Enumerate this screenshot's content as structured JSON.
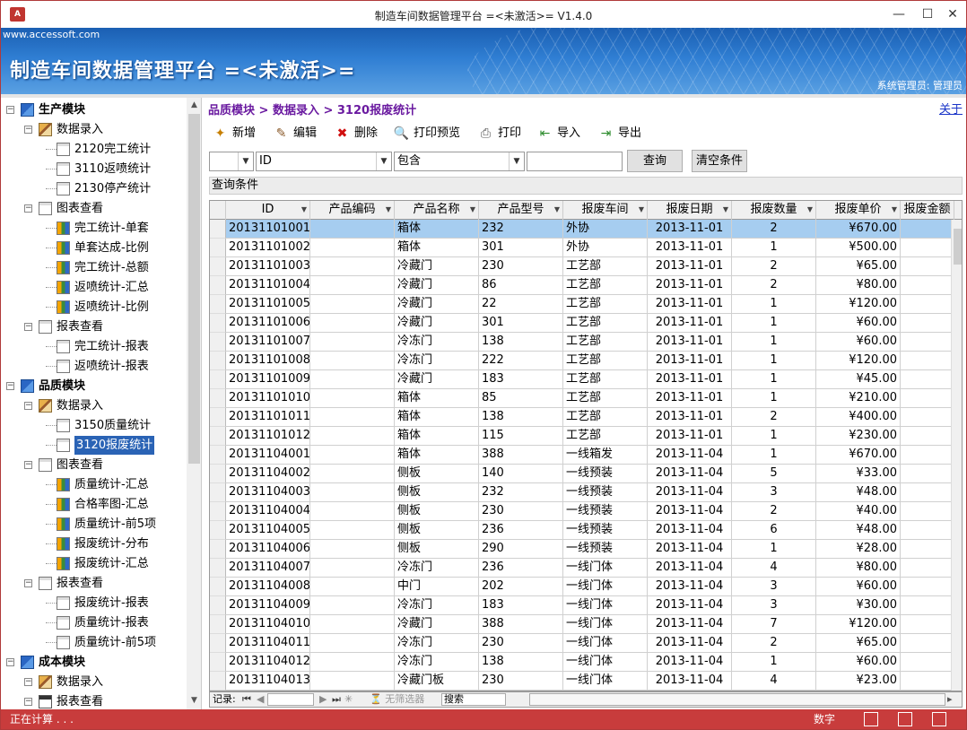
{
  "window": {
    "title": "制造车间数据管理平台 =<未激活>= V1.4.0",
    "app_icon": "A"
  },
  "banner": {
    "url": "www.accessoft.com",
    "title": "制造车间数据管理平台 =<未激活>=",
    "user": "系统管理员: 管理员"
  },
  "tree": {
    "items": [
      {
        "label": "生产模块",
        "level": 0,
        "icon": "module-icon",
        "bold": true
      },
      {
        "label": "数据录入",
        "level": 1,
        "icon": "data-entry-icon"
      },
      {
        "label": "2120完工统计",
        "level": 2,
        "icon": "document-icon"
      },
      {
        "label": "3110返喷统计",
        "level": 2,
        "icon": "document-icon"
      },
      {
        "label": "2130停产统计",
        "level": 2,
        "icon": "document-icon"
      },
      {
        "label": "图表查看",
        "level": 1,
        "icon": "chart-folder-icon"
      },
      {
        "label": "完工统计-单套",
        "level": 2,
        "icon": "chart-icon"
      },
      {
        "label": "单套达成-比例",
        "level": 2,
        "icon": "chart-icon"
      },
      {
        "label": "完工统计-总额",
        "level": 2,
        "icon": "chart-icon"
      },
      {
        "label": "返喷统计-汇总",
        "level": 2,
        "icon": "chart-icon"
      },
      {
        "label": "返喷统计-比例",
        "level": 2,
        "icon": "chart-icon"
      },
      {
        "label": "报表查看",
        "level": 1,
        "icon": "chart-folder-icon"
      },
      {
        "label": "完工统计-报表",
        "level": 2,
        "icon": "document-icon"
      },
      {
        "label": "返喷统计-报表",
        "level": 2,
        "icon": "document-icon"
      },
      {
        "label": "品质模块",
        "level": 0,
        "icon": "module-icon",
        "bold": true
      },
      {
        "label": "数据录入",
        "level": 1,
        "icon": "data-entry-icon"
      },
      {
        "label": "3150质量统计",
        "level": 2,
        "icon": "document-icon"
      },
      {
        "label": "3120报废统计",
        "level": 2,
        "icon": "document-icon",
        "selected": true
      },
      {
        "label": "图表查看",
        "level": 1,
        "icon": "chart-folder-icon"
      },
      {
        "label": "质量统计-汇总",
        "level": 2,
        "icon": "chart-icon"
      },
      {
        "label": "合格率图-汇总",
        "level": 2,
        "icon": "chart-icon"
      },
      {
        "label": "质量统计-前5项",
        "level": 2,
        "icon": "chart-icon"
      },
      {
        "label": "报废统计-分布",
        "level": 2,
        "icon": "chart-icon"
      },
      {
        "label": "报废统计-汇总",
        "level": 2,
        "icon": "chart-icon"
      },
      {
        "label": "报表查看",
        "level": 1,
        "icon": "chart-folder-icon"
      },
      {
        "label": "报废统计-报表",
        "level": 2,
        "icon": "document-icon"
      },
      {
        "label": "质量统计-报表",
        "level": 2,
        "icon": "document-icon"
      },
      {
        "label": "质量统计-前5项",
        "level": 2,
        "icon": "document-icon"
      },
      {
        "label": "成本模块",
        "level": 0,
        "icon": "module-icon",
        "bold": true
      },
      {
        "label": "数据录入",
        "level": 1,
        "icon": "data-entry-icon"
      },
      {
        "label": "报表查看",
        "level": 1,
        "icon": "report-icon"
      }
    ]
  },
  "main": {
    "breadcrumb": "品质模块 > 数据录入 > 3120报废统计",
    "about": "关于",
    "toolbar": [
      {
        "label": "新增",
        "icon": "add-icon"
      },
      {
        "label": "编辑",
        "icon": "edit-icon"
      },
      {
        "label": "删除",
        "icon": "delete-icon"
      },
      {
        "label": "打印预览",
        "icon": "print-preview-icon"
      },
      {
        "label": "打印",
        "icon": "print-icon"
      },
      {
        "label": "导入",
        "icon": "import-icon"
      },
      {
        "label": "导出",
        "icon": "export-icon"
      }
    ],
    "filter": {
      "field1": "",
      "field2": "ID",
      "operator": "包含",
      "value": "",
      "query_label": "查询",
      "clear_label": "清空条件"
    },
    "condition_label": "查询条件",
    "columns": [
      "ID",
      "产品编码",
      "产品名称",
      "产品型号",
      "报废车间",
      "报废日期",
      "报废数量",
      "报废单价",
      "报废金额"
    ],
    "rows": [
      [
        "20131101001",
        "",
        "箱体",
        "232",
        "外协",
        "2013-11-01",
        "2",
        "¥670.00"
      ],
      [
        "20131101002",
        "",
        "箱体",
        "301",
        "外协",
        "2013-11-01",
        "1",
        "¥500.00"
      ],
      [
        "20131101003",
        "",
        "冷藏门",
        "230",
        "工艺部",
        "2013-11-01",
        "2",
        "¥65.00"
      ],
      [
        "20131101004",
        "",
        "冷藏门",
        "86",
        "工艺部",
        "2013-11-01",
        "2",
        "¥80.00"
      ],
      [
        "20131101005",
        "",
        "冷藏门",
        "22",
        "工艺部",
        "2013-11-01",
        "1",
        "¥120.00"
      ],
      [
        "20131101006",
        "",
        "冷藏门",
        "301",
        "工艺部",
        "2013-11-01",
        "1",
        "¥60.00"
      ],
      [
        "20131101007",
        "",
        "冷冻门",
        "138",
        "工艺部",
        "2013-11-01",
        "1",
        "¥60.00"
      ],
      [
        "20131101008",
        "",
        "冷冻门",
        "222",
        "工艺部",
        "2013-11-01",
        "1",
        "¥120.00"
      ],
      [
        "20131101009",
        "",
        "冷藏门",
        "183",
        "工艺部",
        "2013-11-01",
        "1",
        "¥45.00"
      ],
      [
        "20131101010",
        "",
        "箱体",
        "85",
        "工艺部",
        "2013-11-01",
        "1",
        "¥210.00"
      ],
      [
        "20131101011",
        "",
        "箱体",
        "138",
        "工艺部",
        "2013-11-01",
        "2",
        "¥400.00"
      ],
      [
        "20131101012",
        "",
        "箱体",
        "115",
        "工艺部",
        "2013-11-01",
        "1",
        "¥230.00"
      ],
      [
        "20131104001",
        "",
        "箱体",
        "388",
        "一线箱发",
        "2013-11-04",
        "1",
        "¥670.00"
      ],
      [
        "20131104002",
        "",
        "侧板",
        "140",
        "一线预装",
        "2013-11-04",
        "5",
        "¥33.00"
      ],
      [
        "20131104003",
        "",
        "侧板",
        "232",
        "一线预装",
        "2013-11-04",
        "3",
        "¥48.00"
      ],
      [
        "20131104004",
        "",
        "侧板",
        "230",
        "一线预装",
        "2013-11-04",
        "2",
        "¥40.00"
      ],
      [
        "20131104005",
        "",
        "侧板",
        "236",
        "一线预装",
        "2013-11-04",
        "6",
        "¥48.00"
      ],
      [
        "20131104006",
        "",
        "侧板",
        "290",
        "一线预装",
        "2013-11-04",
        "1",
        "¥28.00"
      ],
      [
        "20131104007",
        "",
        "冷冻门",
        "236",
        "一线门体",
        "2013-11-04",
        "4",
        "¥80.00"
      ],
      [
        "20131104008",
        "",
        "中门",
        "202",
        "一线门体",
        "2013-11-04",
        "3",
        "¥60.00"
      ],
      [
        "20131104009",
        "",
        "冷冻门",
        "183",
        "一线门体",
        "2013-11-04",
        "3",
        "¥30.00"
      ],
      [
        "20131104010",
        "",
        "冷藏门",
        "388",
        "一线门体",
        "2013-11-04",
        "7",
        "¥120.00"
      ],
      [
        "20131104011",
        "",
        "冷冻门",
        "230",
        "一线门体",
        "2013-11-04",
        "2",
        "¥65.00"
      ],
      [
        "20131104012",
        "",
        "冷冻门",
        "138",
        "一线门体",
        "2013-11-04",
        "1",
        "¥60.00"
      ],
      [
        "20131104013",
        "",
        "冷藏门板",
        "230",
        "一线门体",
        "2013-11-04",
        "4",
        "¥23.00"
      ]
    ],
    "selected_row": 0,
    "navbar": {
      "record_label": "记录:",
      "no_filter": "无筛选器",
      "search": "搜索"
    }
  },
  "status": {
    "left": "正在计算 . . .",
    "mode": "数字"
  },
  "colors": {
    "accent": "#2a63b5",
    "status_bar": "#c83c3c",
    "breadcrumb": "#6a1aa0",
    "selected_row": "#a6cdf0"
  }
}
